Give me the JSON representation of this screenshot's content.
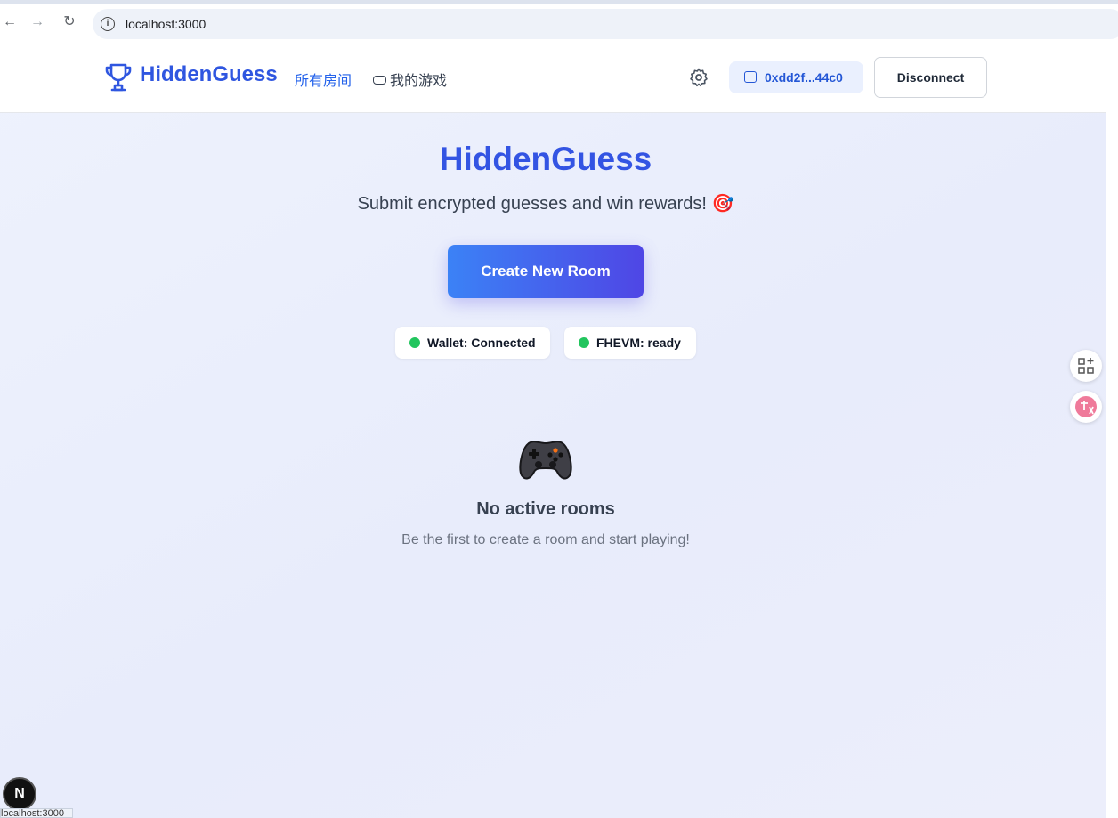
{
  "browser": {
    "url": "localhost:3000",
    "back_glyph": "←",
    "forward_glyph": "→",
    "reload_glyph": "↻"
  },
  "header": {
    "logo_text": "HiddenGuess",
    "nav": [
      {
        "label": "所有房间",
        "active": true
      },
      {
        "label": "我的游戏",
        "active": false
      }
    ],
    "wallet_address": "0xdd2f...44c0",
    "disconnect_label": "Disconnect"
  },
  "hero": {
    "title": "HiddenGuess",
    "subtitle": "Submit encrypted guesses and win rewards! 🎯",
    "create_button": "Create New Room"
  },
  "status": [
    {
      "label": "Wallet: Connected",
      "color": "#22c55e"
    },
    {
      "label": "FHEVM: ready",
      "color": "#22c55e"
    }
  ],
  "empty_state": {
    "icon": "🎮",
    "title": "No active rooms",
    "subtitle": "Be the first to create a room and start playing!"
  },
  "dev_badge": "N",
  "status_bar_url": "localhost:3000",
  "colors": {
    "accent": "#2f56e0",
    "button_gradient_start": "#3b82f6",
    "button_gradient_end": "#4f46e5",
    "status_ok": "#22c55e"
  }
}
